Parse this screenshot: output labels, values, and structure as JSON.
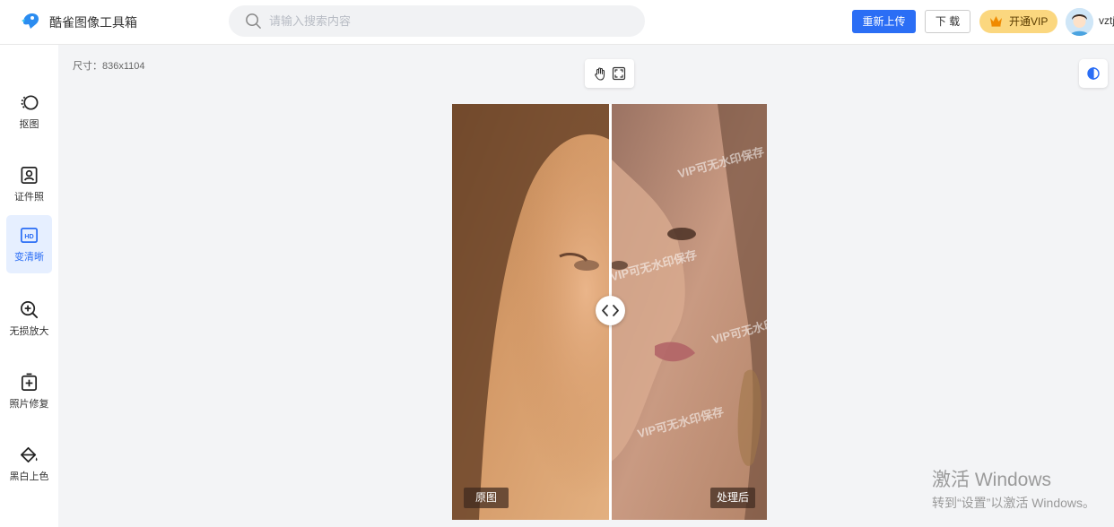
{
  "header": {
    "app_title": "酷雀图像工具箱",
    "search_placeholder": "请输入搜索内容",
    "reupload_label": "重新上传",
    "download_label": "下 载",
    "vip_label": "开通VIP",
    "username": "vztj"
  },
  "sidebar": {
    "items": [
      {
        "label": "抠图",
        "icon": "cutout-icon"
      },
      {
        "label": "证件照",
        "icon": "id-photo-icon"
      },
      {
        "label": "变清晰",
        "icon": "hd-icon",
        "active": true
      },
      {
        "label": "无损放大",
        "icon": "zoom-in-icon"
      },
      {
        "label": "照片修复",
        "icon": "photo-repair-icon"
      },
      {
        "label": "黑白上色",
        "icon": "colorize-icon"
      }
    ]
  },
  "canvas": {
    "size_text": "尺寸：836x1104",
    "tools": [
      "hand-icon",
      "fit-screen-icon"
    ],
    "compare_icon": "compare-icon",
    "label_before": "原图",
    "label_after": "处理后",
    "watermark_text": "VIP可无水印保存"
  },
  "os_notice": {
    "line1": "激活 Windows",
    "line2": "转到“设置”以激活 Windows。"
  },
  "colors": {
    "accent": "#2b6ef5",
    "vip": "#fbd77f",
    "active_bg": "#e6efff"
  }
}
